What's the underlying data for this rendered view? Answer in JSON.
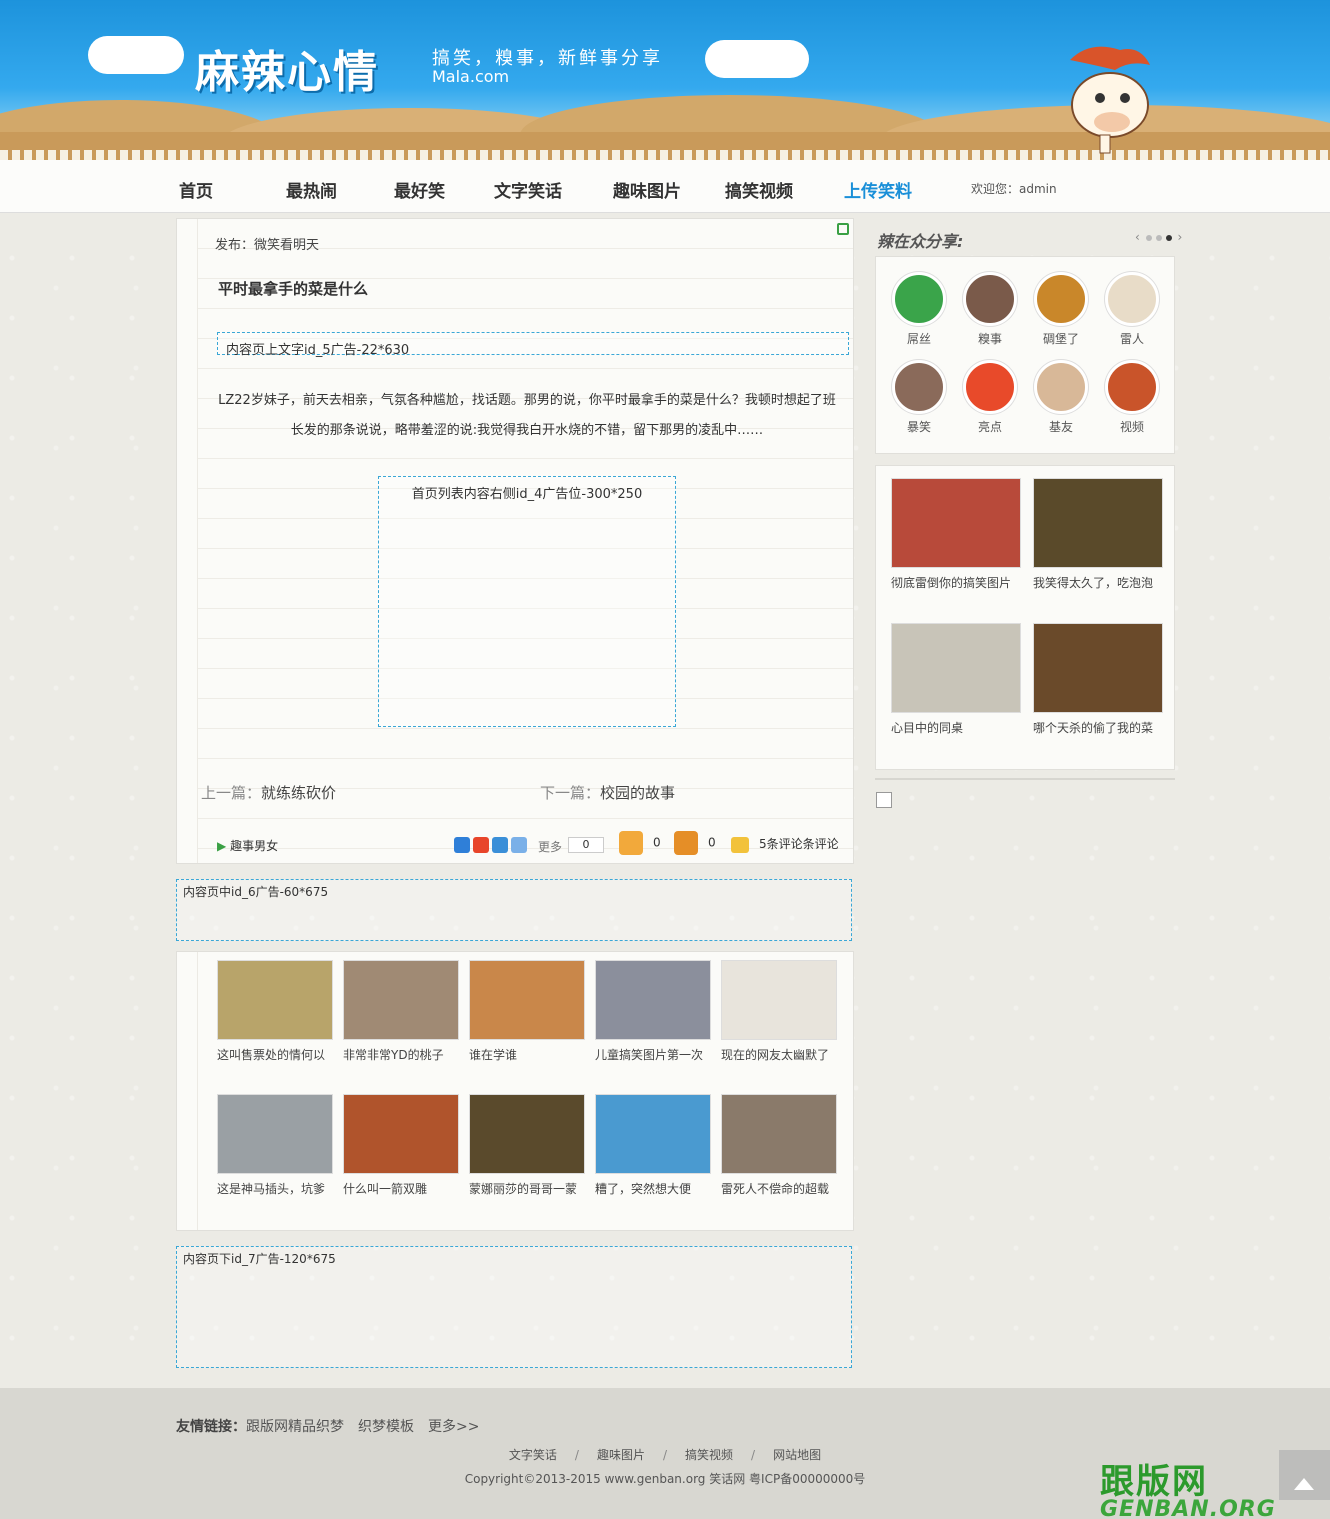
{
  "header": {
    "site_title": "麻辣心情",
    "slogan": "搞笑，糗事，新鲜事分享",
    "domain": "Mala.com"
  },
  "nav": {
    "items": [
      {
        "label": "首页"
      },
      {
        "label": "最热闹"
      },
      {
        "label": "最好笑"
      },
      {
        "label": "文字笑话"
      },
      {
        "label": "趣味图片"
      },
      {
        "label": "搞笑视频"
      },
      {
        "label": "上传笑料",
        "active": true
      }
    ],
    "welcome": "欢迎您：admin"
  },
  "post": {
    "publisher": "发布：微笑看明天",
    "title": "平时最拿手的菜是什么",
    "ad_top": "内容页上文字id_5广告-22*630",
    "body": "LZ22岁妹子，前天去相亲，气氛各种尴尬，找话题。那男的说，你平时最拿手的菜是什么？我顿时想起了班长发的那条说说，略带羞涩的说:我觉得我白开水烧的不错，留下那男的凌乱中……",
    "ad_mid": "首页列表内容右侧id_4广告位-300*250",
    "prev_label": "上一篇：",
    "prev_title": "就练练砍价",
    "next_label": "下一篇：",
    "next_title": "校园的故事",
    "tag": "趣事男女",
    "share_more": "更多",
    "share_count": "0",
    "likes": "0",
    "dislikes": "0",
    "comments": "5条评论条评论"
  },
  "ads": {
    "ad6": "内容页中id_6广告-60*675",
    "ad7": "内容页下id_7广告-120*675"
  },
  "gallery": [
    {
      "caption": "这叫售票处的情何以",
      "color": "#b8a46a"
    },
    {
      "caption": "非常非常YD的桃子",
      "color": "#a08a74"
    },
    {
      "caption": "谁在学谁",
      "color": "#c9874a"
    },
    {
      "caption": "儿童搞笑图片第一次",
      "color": "#8b8f9c"
    },
    {
      "caption": "现在的网友太幽默了",
      "color": "#e8e4dc"
    },
    {
      "caption": "这是神马插头，坑爹",
      "color": "#9aa0a4"
    },
    {
      "caption": "什么叫一箭双雕",
      "color": "#b0542c"
    },
    {
      "caption": "蒙娜丽莎的哥哥一蒙",
      "color": "#5a4a2c"
    },
    {
      "caption": "糟了，突然想大便",
      "color": "#4a9ad0"
    },
    {
      "caption": "雷死人不偿命的超载",
      "color": "#8a7a6a"
    }
  ],
  "sidebar": {
    "title": "辣在众分享:",
    "avatars": [
      {
        "name": "屌丝",
        "color": "#3aa44a"
      },
      {
        "name": "糗事",
        "color": "#7a5a4a"
      },
      {
        "name": "碉堡了",
        "color": "#c9872a"
      },
      {
        "name": "雷人",
        "color": "#e8dcc8"
      },
      {
        "name": "暴笑",
        "color": "#8a6a5a"
      },
      {
        "name": "亮点",
        "color": "#e84a2a"
      },
      {
        "name": "基友",
        "color": "#d8b898"
      },
      {
        "name": "视频",
        "color": "#c9542a"
      }
    ],
    "hot": [
      {
        "caption": "彻底雷倒你的搞笑图片",
        "color": "#b84a3a"
      },
      {
        "caption": "我笑得太久了，吃泡泡",
        "color": "#5a4a2a"
      },
      {
        "caption": "心目中的同桌",
        "color": "#c8c4b8"
      },
      {
        "caption": "哪个天杀的偷了我的菜",
        "color": "#6a4a2a"
      }
    ]
  },
  "footer": {
    "friend_label": "友情链接：",
    "friend_links": [
      "跟版网精品织梦",
      "织梦模板",
      "更多>>"
    ],
    "nav": [
      "文字笑话",
      "趣味图片",
      "搞笑视频",
      "网站地图"
    ],
    "nav_sep": "/",
    "copyright": "Copyright©2013-2015 www.genban.org 笑话网 粤ICP备00000000号",
    "watermark_cn": "跟版网",
    "watermark_en": "GENBAN.ORG"
  }
}
